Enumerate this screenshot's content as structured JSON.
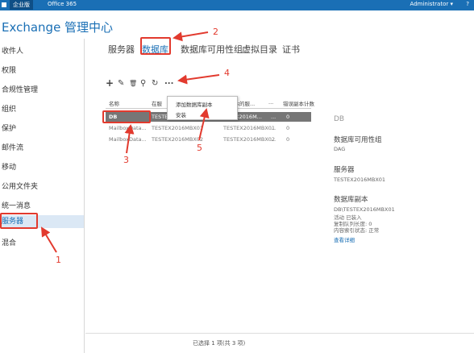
{
  "topbar": {
    "tab_enterprise": "企业版",
    "tab_office365": "Office 365",
    "user": "Administrator",
    "user_caret": "▾",
    "help": "?"
  },
  "app": {
    "title": "Exchange 管理中心"
  },
  "sidebar": {
    "items": [
      {
        "label": "收件人"
      },
      {
        "label": "权限"
      },
      {
        "label": "合规性管理"
      },
      {
        "label": "组织"
      },
      {
        "label": "保护"
      },
      {
        "label": "邮件流"
      },
      {
        "label": "移动"
      },
      {
        "label": "公用文件夹"
      },
      {
        "label": "统一消息"
      },
      {
        "label": "服务器"
      },
      {
        "label": "混合"
      }
    ],
    "selected_index": 9
  },
  "tabs": [
    {
      "label": "服务器"
    },
    {
      "label": "数据库"
    },
    {
      "label": "数据库可用性组"
    },
    {
      "label": "虚拟目录"
    },
    {
      "label": "证书"
    }
  ],
  "toolbar": {
    "add": "+",
    "edit": "✎",
    "delete": "🗑",
    "search": "⚲",
    "refresh": "↻",
    "more": "..."
  },
  "grid": {
    "headers": [
      "名称",
      "在服",
      "副本的服...",
      "...",
      "错误副本计数"
    ],
    "rows": [
      {
        "name": "DB",
        "server": "TESTE",
        "replica": "TEX2016M...",
        "dots": "...",
        "error": "0"
      },
      {
        "name": "MailboxData...",
        "server": "TESTEX2016MBX01",
        "replica": "TESTEX2016MBX01",
        "dots": "...",
        "error": "0"
      },
      {
        "name": "MailboxData...",
        "server": "TESTEX2016MBX02",
        "replica": "TESTEX2016MBX02",
        "dots": "...",
        "error": "0"
      }
    ]
  },
  "context_menu": {
    "items": [
      {
        "label": "添加数据库副本"
      },
      {
        "label": "安装"
      }
    ]
  },
  "details": {
    "title": "DB",
    "dag_heading": "数据库可用性组",
    "dag_value": "DAG",
    "servers_heading": "服务器",
    "servers_value": "TESTEX2016MBX01",
    "copies_heading": "数据库副本",
    "copy_name": "DB\\TESTEX2016MBX01",
    "copy_status": "活动 已装入",
    "copy_queue": "复制队列长度: 0",
    "copy_index": "内容索引状态: 正常",
    "view_details": "查看详细"
  },
  "footer": {
    "selection": "已选择 1 项(共 3 项)"
  },
  "annotations": [
    "1",
    "2",
    "3",
    "4",
    "5"
  ],
  "colors": {
    "brand": "#1a6fb5",
    "annotation": "#e23a2e",
    "selected_row": "#767676"
  }
}
